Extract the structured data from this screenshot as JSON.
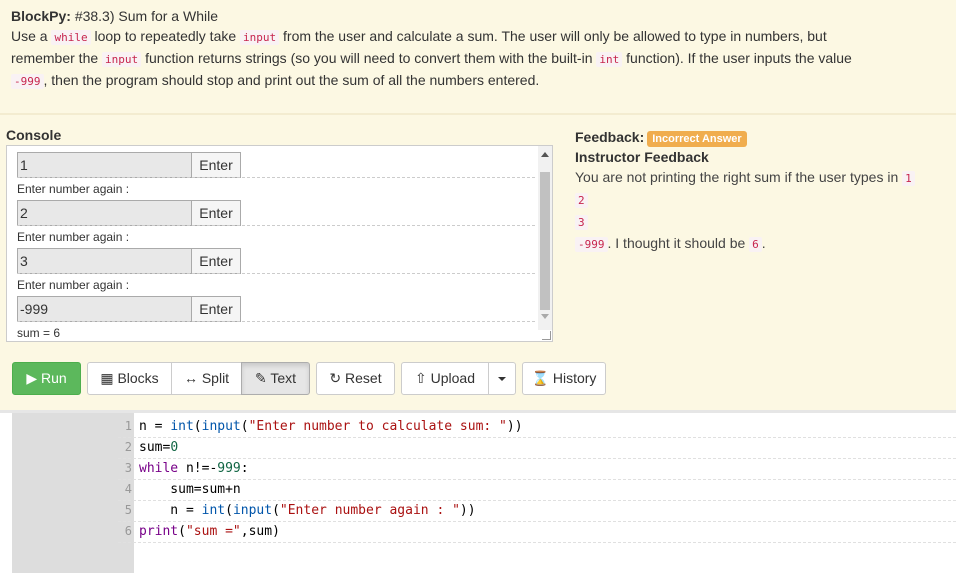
{
  "instructions": {
    "title_prefix": "BlockPy:",
    "title": "#38.3) Sum for a While",
    "p1": "Use a",
    "c1": "while",
    "p2": "loop to repeatedly take",
    "c2": "input",
    "p3": "from the user and calculate a sum. The user will only be allowed to type in numbers, but remember the",
    "c3": "input",
    "p4": "function returns strings (so you will need to convert them with the built-in",
    "c4": "int",
    "p5": "function). If the user inputs the value",
    "c5": "-999",
    "p6": ", then the program should stop and print out the sum of all the numbers entered."
  },
  "console": {
    "label": "Console",
    "enter_label": "Enter",
    "inputs": [
      "1",
      "2",
      "3",
      "-999"
    ],
    "prompts": [
      "Enter number again :",
      "Enter number again :",
      "Enter number again :"
    ],
    "output": "sum = 6"
  },
  "feedback": {
    "label": "Feedback:",
    "badge": "Incorrect Answer",
    "subtitle": "Instructor Feedback",
    "text1": "You are not printing the right sum if the user types in",
    "v1": "1",
    "v2": "2",
    "v3": "3",
    "v4": "-999",
    "text2": ". I thought it should be",
    "v5": "6",
    "text3": "."
  },
  "toolbar": {
    "run": "Run",
    "blocks": "Blocks",
    "split": "Split",
    "text": "Text",
    "reset": "Reset",
    "upload": "Upload",
    "history": "History"
  },
  "editor": {
    "line_numbers": [
      "1",
      "2",
      "3",
      "4",
      "5",
      "6"
    ]
  },
  "colors": {
    "top_background": "#fcf8e3",
    "run_button": "#5cb85c",
    "badge": "#f0ad4e",
    "code_highlight": "#c7254e"
  }
}
